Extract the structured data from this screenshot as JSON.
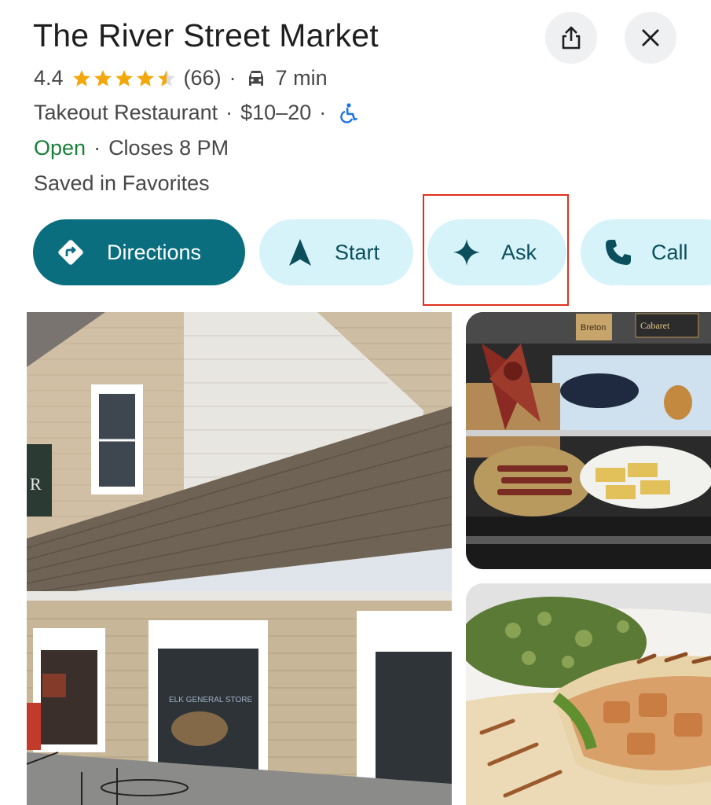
{
  "place": {
    "name": "The River Street Market",
    "rating": "4.4",
    "star_count": 4.5,
    "reviews": "(66)",
    "drive_time": "7 min",
    "category": "Takeout Restaurant",
    "price": "$10–20",
    "status": "Open",
    "closes": "Closes 8 PM",
    "saved": "Saved in Favorites",
    "separator": "·"
  },
  "actions": {
    "directions": "Directions",
    "start": "Start",
    "ask": "Ask",
    "call": "Call"
  },
  "icons": {
    "share": "share-icon",
    "close": "close-icon",
    "car": "car-icon",
    "accessible": "wheelchair-icon",
    "directions": "directions-icon",
    "start": "navigation-arrow-icon",
    "ask": "sparkle-icon",
    "call": "phone-icon"
  },
  "photos": {
    "main_storefront_sign": "R",
    "main_window_sign": "ELK GENERAL STORE",
    "side_cheese_label_1": "Breton",
    "side_cheese_label_2": "Cabaret"
  },
  "colors": {
    "primary": "#0b6e7f",
    "tonal": "#d6f3fa",
    "open": "#188038",
    "star": "#f2a80c",
    "highlight": "#e0301e"
  }
}
